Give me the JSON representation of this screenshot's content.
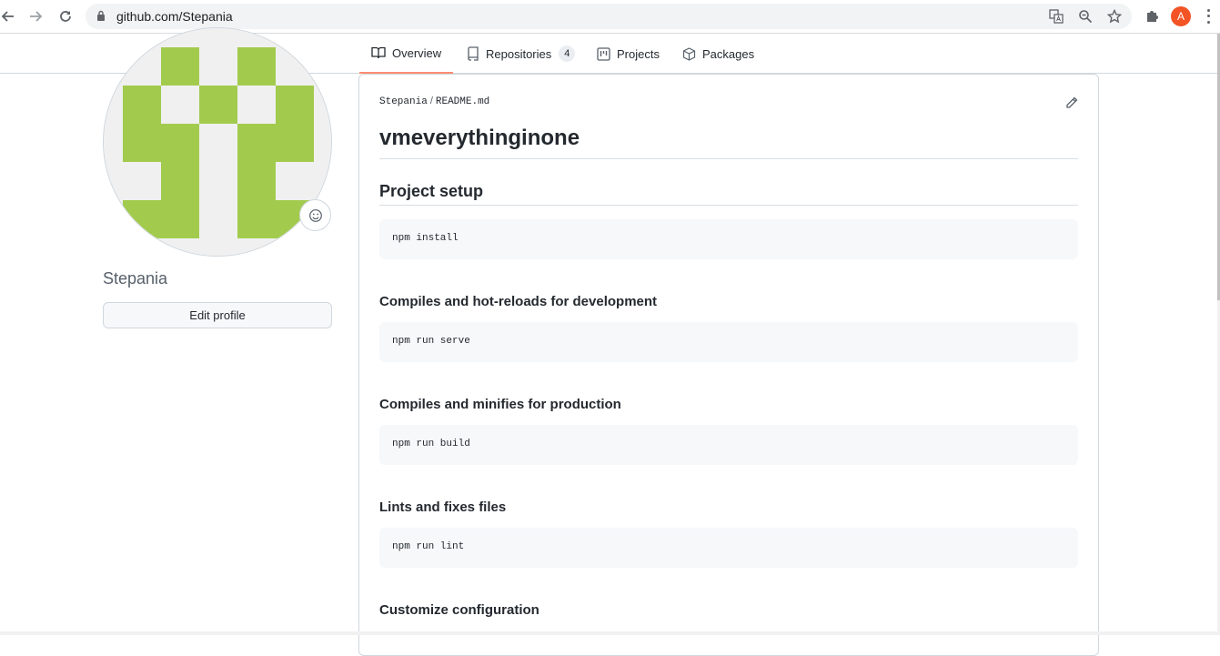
{
  "browser": {
    "url": "github.com/Stepania",
    "profile_initial": "A"
  },
  "tabs": [
    {
      "label": "Overview",
      "selected": true
    },
    {
      "label": "Repositories",
      "count": "4"
    },
    {
      "label": "Projects"
    },
    {
      "label": "Packages"
    }
  ],
  "profile": {
    "username": "Stepania",
    "edit_label": "Edit profile"
  },
  "readme": {
    "owner": "Stepania",
    "file": "README.md",
    "title": "vmeverythinginone",
    "section_heading": "Project setup",
    "blocks": [
      {
        "heading": "",
        "code": "npm install"
      },
      {
        "heading": "Compiles and hot-reloads for development",
        "code": "npm run serve"
      },
      {
        "heading": "Compiles and minifies for production",
        "code": "npm run build"
      },
      {
        "heading": "Lints and fixes files",
        "code": "npm run lint"
      }
    ],
    "last_heading": "Customize configuration"
  },
  "colors": {
    "avatar_green": "#a2cb4e",
    "avatar_bg": "#f0f0f0",
    "tab_underline": "#fd8c73"
  }
}
